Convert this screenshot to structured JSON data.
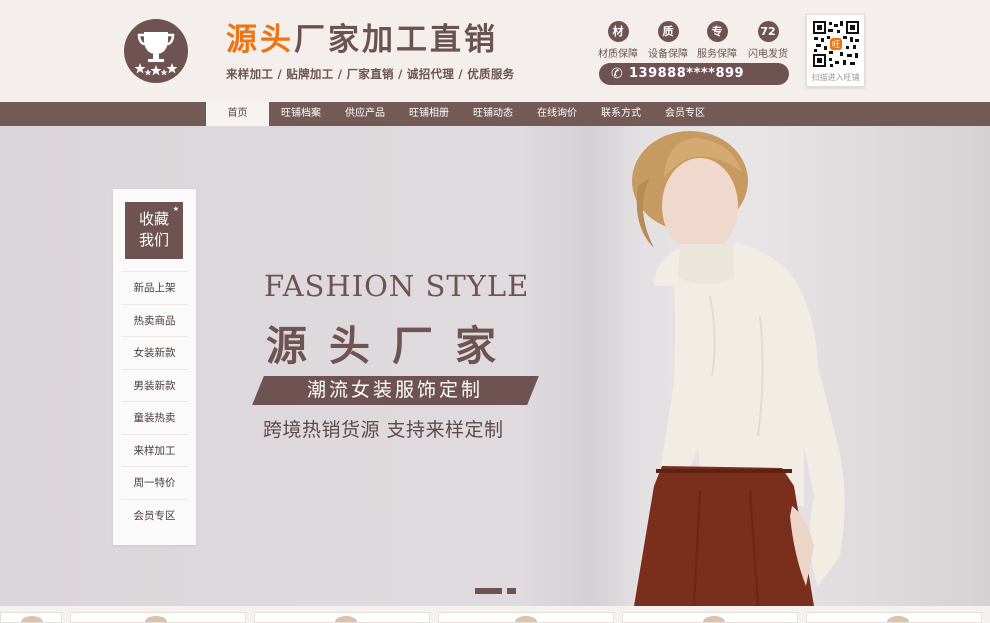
{
  "header": {
    "logo_icon": "trophy-stars-icon",
    "title_accent": "源头",
    "title_rest": "厂家加工直销",
    "subtitle": "来样加工 / 贴牌加工 / 厂家直销 / 诚招代理 / 优质服务",
    "badges": [
      {
        "glyph": "材",
        "caption": "材质保障"
      },
      {
        "glyph": "质",
        "caption": "设备保障"
      },
      {
        "glyph": "专",
        "caption": "服务保障"
      },
      {
        "glyph": "72",
        "caption": "闪电发货"
      }
    ],
    "phone": "139888****899",
    "qr_caption": "扫描进入旺铺"
  },
  "nav": {
    "items": [
      "首页",
      "旺铺档案",
      "供应产品",
      "旺铺相册",
      "旺铺动态",
      "在线询价",
      "联系方式",
      "会员专区"
    ],
    "active_index": 0
  },
  "sidebar": {
    "fav_line1": "收藏",
    "fav_line2": "我们",
    "items": [
      "新品上架",
      "热卖商品",
      "女装新款",
      "男装新款",
      "童装热卖",
      "来样加工",
      "周一特价",
      "会员专区"
    ]
  },
  "banner": {
    "headline_en": "FASHION STYLE",
    "headline_cn": "源头厂家",
    "slogan": "潮流女装服饰定制",
    "tagline": "跨境热销货源 支持来样定制",
    "slide_count": 2,
    "active_slide": 0
  },
  "colors": {
    "brand": "#6e5352",
    "accent": "#ee7414",
    "nav_bg": "#735a57"
  }
}
